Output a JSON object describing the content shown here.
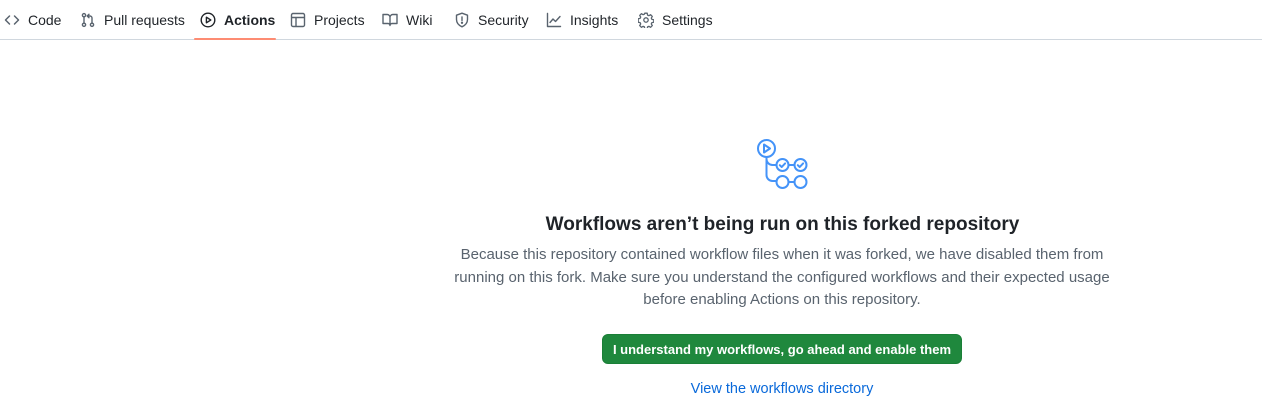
{
  "nav": {
    "tabs": [
      {
        "label": "Code",
        "icon": "code-icon"
      },
      {
        "label": "Pull requests",
        "icon": "git-pull-request-icon"
      },
      {
        "label": "Actions",
        "icon": "play-circle-icon",
        "active": true
      },
      {
        "label": "Projects",
        "icon": "table-icon"
      },
      {
        "label": "Wiki",
        "icon": "book-icon"
      },
      {
        "label": "Security",
        "icon": "shield-icon"
      },
      {
        "label": "Insights",
        "icon": "graph-icon"
      },
      {
        "label": "Settings",
        "icon": "gear-icon"
      }
    ],
    "active_underline_color": "#fd8c73"
  },
  "main": {
    "icon": "workflow-icon",
    "heading": "Workflows aren’t being run on this forked repository",
    "description": "Because this repository contained workflow files when it was forked, we have disabled them from running on this fork. Make sure you understand the configured workflows and their expected usage before enabling Actions on this repository.",
    "enable_button_label": "I understand my workflows, go ahead and enable them",
    "view_link_label": "View the workflows directory"
  },
  "colors": {
    "primary_button": "#1f883d",
    "link": "#0969da",
    "icon_accent": "#4493f8"
  }
}
